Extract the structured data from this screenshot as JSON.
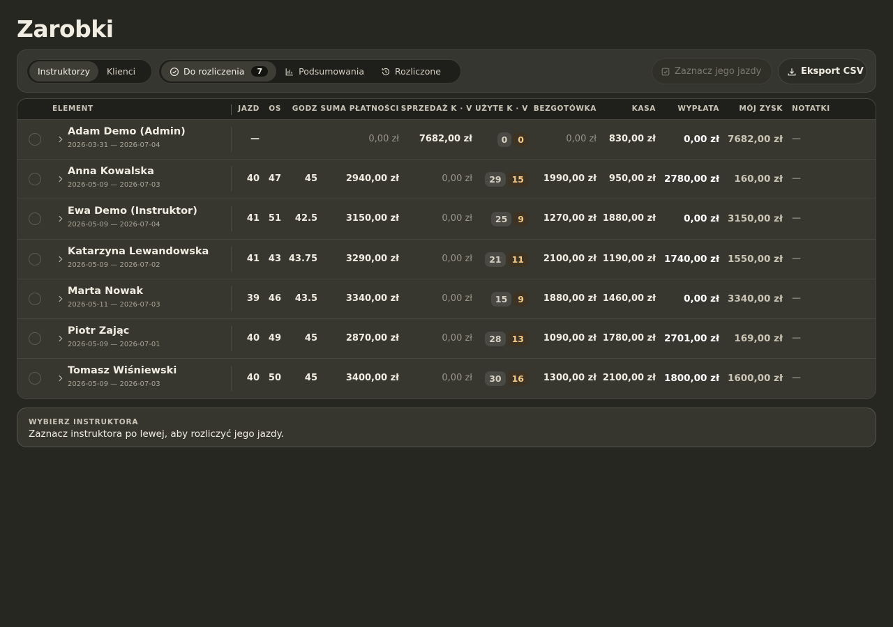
{
  "page": {
    "title": "Zarobki"
  },
  "toolbar": {
    "view_toggle": [
      {
        "label": "Instruktorzy",
        "active": true
      },
      {
        "label": "Klienci",
        "active": false
      }
    ],
    "tabs": [
      {
        "label": "Do rozliczenia",
        "icon": "check-circle-icon",
        "count": "7",
        "active": true
      },
      {
        "label": "Podsumowania",
        "icon": "bar-chart-icon",
        "active": false
      },
      {
        "label": "Rozliczone",
        "icon": "history-icon",
        "active": false
      }
    ],
    "mark_button": {
      "label": "Zaznacz jego jazdy",
      "icon": "checkbox-icon",
      "disabled": true
    },
    "export_button": {
      "label": "Eksport CSV",
      "icon": "download-icon"
    }
  },
  "table": {
    "columns": {
      "element": "ELEMENT",
      "jazd": "JAZD",
      "os": "OS",
      "godz": "GODZ",
      "suma": "SUMA PŁATNOŚCI",
      "sprzedaz": "SPRZEDAŻ K · V",
      "uzyte": "UŻYTE K · V",
      "bezgotowka": "BEZGOTÓWKA",
      "kasa": "KASA",
      "wyplata": "WYPŁATA",
      "zysk": "MÓJ ZYSK",
      "notatki": "NOTATKI"
    },
    "rows": [
      {
        "name": "Adam Demo (Admin)",
        "range": "2026-03-31 — 2026-07-04",
        "jazd": "—",
        "os": "",
        "godz": "",
        "suma": "0,00 zł",
        "suma_dim": true,
        "sprzedaz": "7682,00 zł",
        "sprzedaz_dim": false,
        "k": "0",
        "v": "0",
        "bezgotowka": "0,00 zł",
        "bezgotowka_dim": true,
        "kasa": "830,00 zł",
        "wyplata": "0,00 zł",
        "zysk": "7682,00 zł",
        "note": "—"
      },
      {
        "name": "Anna Kowalska",
        "range": "2026-05-09 — 2026-07-03",
        "jazd": "40",
        "os": "47",
        "godz": "45",
        "suma": "2940,00 zł",
        "suma_dim": false,
        "sprzedaz": "0,00 zł",
        "sprzedaz_dim": true,
        "k": "29",
        "v": "15",
        "bezgotowka": "1990,00 zł",
        "bezgotowka_dim": false,
        "kasa": "950,00 zł",
        "wyplata": "2780,00 zł",
        "zysk": "160,00 zł",
        "note": "—"
      },
      {
        "name": "Ewa Demo (Instruktor)",
        "range": "2026-05-09 — 2026-07-04",
        "jazd": "41",
        "os": "51",
        "godz": "42.5",
        "suma": "3150,00 zł",
        "suma_dim": false,
        "sprzedaz": "0,00 zł",
        "sprzedaz_dim": true,
        "k": "25",
        "v": "9",
        "bezgotowka": "1270,00 zł",
        "bezgotowka_dim": false,
        "kasa": "1880,00 zł",
        "wyplata": "0,00 zł",
        "zysk": "3150,00 zł",
        "note": "—"
      },
      {
        "name": "Katarzyna Lewandowska",
        "range": "2026-05-09 — 2026-07-02",
        "jazd": "41",
        "os": "43",
        "godz": "43.75",
        "suma": "3290,00 zł",
        "suma_dim": false,
        "sprzedaz": "0,00 zł",
        "sprzedaz_dim": true,
        "k": "21",
        "v": "11",
        "bezgotowka": "2100,00 zł",
        "bezgotowka_dim": false,
        "kasa": "1190,00 zł",
        "wyplata": "1740,00 zł",
        "zysk": "1550,00 zł",
        "note": "—"
      },
      {
        "name": "Marta Nowak",
        "range": "2026-05-11 — 2026-07-03",
        "jazd": "39",
        "os": "46",
        "godz": "43.5",
        "suma": "3340,00 zł",
        "suma_dim": false,
        "sprzedaz": "0,00 zł",
        "sprzedaz_dim": true,
        "k": "15",
        "v": "9",
        "bezgotowka": "1880,00 zł",
        "bezgotowka_dim": false,
        "kasa": "1460,00 zł",
        "wyplata": "0,00 zł",
        "zysk": "3340,00 zł",
        "note": "—"
      },
      {
        "name": "Piotr Zając",
        "range": "2026-05-09 — 2026-07-01",
        "jazd": "40",
        "os": "49",
        "godz": "45",
        "suma": "2870,00 zł",
        "suma_dim": false,
        "sprzedaz": "0,00 zł",
        "sprzedaz_dim": true,
        "k": "28",
        "v": "13",
        "bezgotowka": "1090,00 zł",
        "bezgotowka_dim": false,
        "kasa": "1780,00 zł",
        "wyplata": "2701,00 zł",
        "zysk": "169,00 zł",
        "note": "—"
      },
      {
        "name": "Tomasz Wiśniewski",
        "range": "2026-05-09 — 2026-07-03",
        "jazd": "40",
        "os": "50",
        "godz": "45",
        "suma": "3400,00 zł",
        "suma_dim": false,
        "sprzedaz": "0,00 zł",
        "sprzedaz_dim": true,
        "k": "30",
        "v": "16",
        "bezgotowka": "1300,00 zł",
        "bezgotowka_dim": false,
        "kasa": "2100,00 zł",
        "wyplata": "1800,00 zł",
        "zysk": "1600,00 zł",
        "note": "—"
      }
    ]
  },
  "footer": {
    "label": "WYBIERZ INSTRUKTORA",
    "text": "Zaznacz instruktora po lewej, aby rozliczyć jego jazdy."
  }
}
